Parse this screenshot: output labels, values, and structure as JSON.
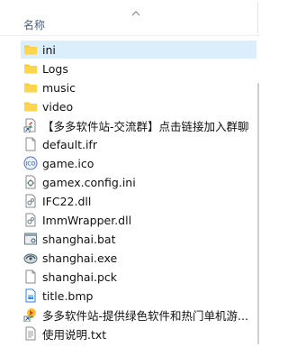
{
  "header": {
    "name_label": "名称"
  },
  "files": [
    {
      "name": "ini",
      "icon": "folder-icon",
      "selected": true
    },
    {
      "name": "Logs",
      "icon": "folder-icon"
    },
    {
      "name": "music",
      "icon": "folder-icon"
    },
    {
      "name": "video",
      "icon": "folder-icon"
    },
    {
      "name": "【多多软件站-交流群】点击链接加入群聊",
      "icon": "shortcut-icon"
    },
    {
      "name": "default.ifr",
      "icon": "file-icon"
    },
    {
      "name": "game.ico",
      "icon": "ico-file-icon"
    },
    {
      "name": "gamex.config.ini",
      "icon": "config-file-icon"
    },
    {
      "name": "IFC22.dll",
      "icon": "dll-file-icon"
    },
    {
      "name": "ImmWrapper.dll",
      "icon": "dll-file-icon"
    },
    {
      "name": "shanghai.bat",
      "icon": "bat-file-icon"
    },
    {
      "name": "shanghai.exe",
      "icon": "exe-file-icon"
    },
    {
      "name": "shanghai.pck",
      "icon": "file-icon"
    },
    {
      "name": "title.bmp",
      "icon": "bmp-file-icon"
    },
    {
      "name": "多多软件站-提供绿色软件和热门单机游...",
      "icon": "url-shortcut-icon"
    },
    {
      "name": "使用说明.txt",
      "icon": "txt-file-icon"
    }
  ],
  "colors": {
    "folder": "#ffca28",
    "selection": "#dbeefc"
  }
}
